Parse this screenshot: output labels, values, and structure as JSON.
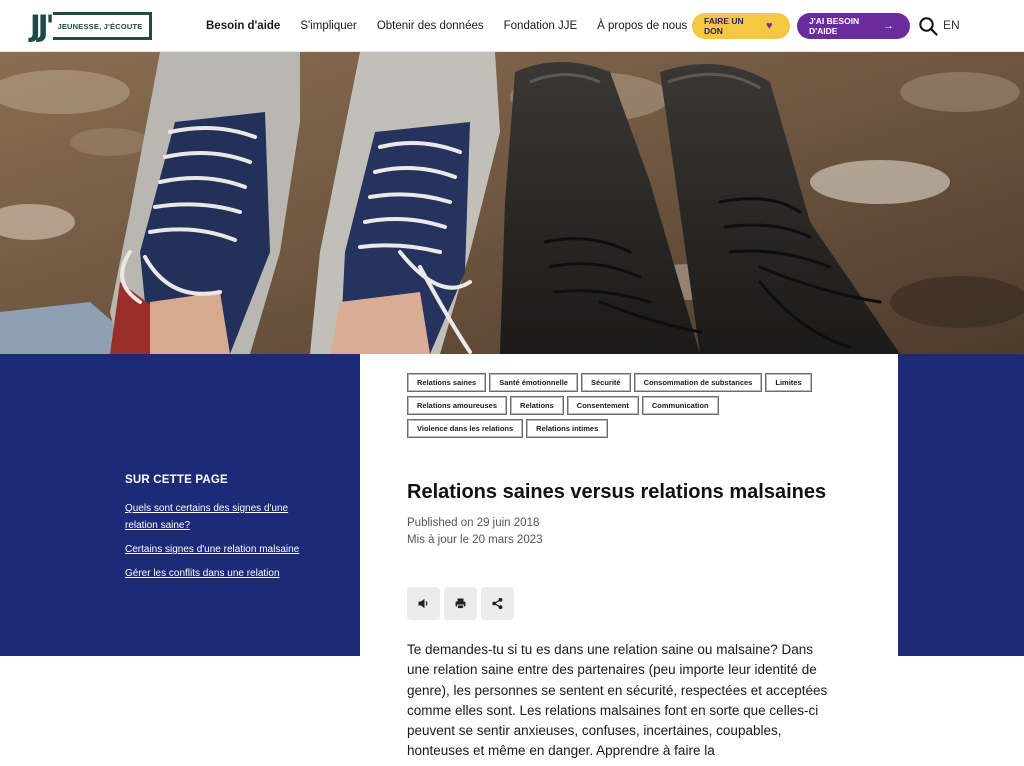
{
  "header": {
    "logo_mark": "JJ'",
    "logo_text": "JEUNESSE, J'ÉCOUTE",
    "nav": [
      {
        "label": "Besoin d'aide"
      },
      {
        "label": "S'impliquer"
      },
      {
        "label": "Obtenir des données"
      },
      {
        "label": "Fondation JJE"
      },
      {
        "label": "À propos de nous"
      }
    ],
    "donate_label": "FAIRE UN DON",
    "help_label": "J'AI BESOIN D'AIDE",
    "lang_label": "EN"
  },
  "tags": {
    "rows": [
      [
        "Relations saines",
        "Santé émotionnelle",
        "Sécurité",
        "Consommation de substances",
        "Limites"
      ],
      [
        "Relations amoureuses",
        "Relations",
        "Consentement",
        "Communication"
      ],
      [
        "Violence dans les relations",
        "Relations intimes"
      ]
    ]
  },
  "toc": {
    "title": "SUR CETTE PAGE",
    "links": [
      {
        "label": "Quels sont certains des signes d'une relation saine?"
      },
      {
        "label": "Certains signes d'une relation malsaine"
      },
      {
        "label": "Gérer les conflits dans une relation"
      }
    ]
  },
  "article": {
    "title": "Relations saines versus relations malsaines",
    "published": "Published on 29 juin 2018",
    "updated": "Mis à jour le 20 mars 2023",
    "intro": "Te demandes-tu si tu es dans une relation saine ou malsaine? Dans une relation saine entre des partenaires (peu importe leur identité de genre), les personnes se sentent en sécurité, respectées et acceptées comme elles sont. Les relations malsaines font en sorte que celles-ci peuvent se sentir anxieuses, confuses, incertaines, coupables, honteuses et même en danger. Apprendre à faire la"
  },
  "colors": {
    "brand_green": "#1f4a46",
    "navy": "#1c2a78",
    "donate_yellow": "#f4c842",
    "help_purple": "#6a2c9c"
  },
  "icons": {
    "donate": "heart-icon",
    "help": "arrow-right-icon",
    "search": "search-icon",
    "tools": [
      "speaker-icon",
      "print-icon",
      "share-icon"
    ]
  }
}
